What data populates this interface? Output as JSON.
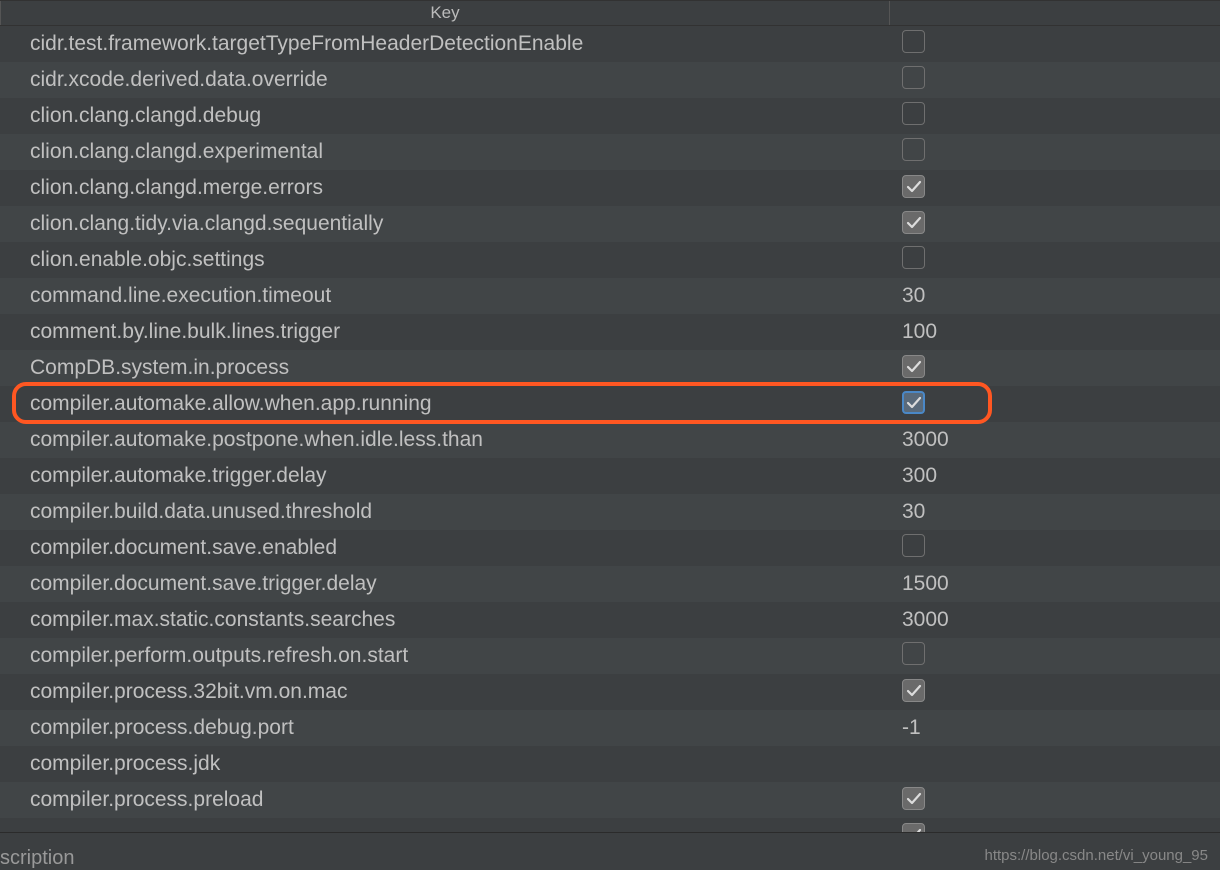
{
  "header": {
    "key_label": "Key"
  },
  "rows": [
    {
      "key": "cidr.test.framework.targetTypeFromHeaderDetectionEnable",
      "type": "checkbox",
      "checked": false,
      "focused": false
    },
    {
      "key": "cidr.xcode.derived.data.override",
      "type": "checkbox",
      "checked": false,
      "focused": false
    },
    {
      "key": "clion.clang.clangd.debug",
      "type": "checkbox",
      "checked": false,
      "focused": false
    },
    {
      "key": "clion.clang.clangd.experimental",
      "type": "checkbox",
      "checked": false,
      "focused": false
    },
    {
      "key": "clion.clang.clangd.merge.errors",
      "type": "checkbox",
      "checked": true,
      "focused": false
    },
    {
      "key": "clion.clang.tidy.via.clangd.sequentially",
      "type": "checkbox",
      "checked": true,
      "focused": false
    },
    {
      "key": "clion.enable.objc.settings",
      "type": "checkbox",
      "checked": false,
      "focused": false
    },
    {
      "key": "command.line.execution.timeout",
      "type": "text",
      "value": "30"
    },
    {
      "key": "comment.by.line.bulk.lines.trigger",
      "type": "text",
      "value": "100"
    },
    {
      "key": "CompDB.system.in.process",
      "type": "checkbox",
      "checked": true,
      "focused": false
    },
    {
      "key": "compiler.automake.allow.when.app.running",
      "type": "checkbox",
      "checked": true,
      "focused": true,
      "highlighted": true
    },
    {
      "key": "compiler.automake.postpone.when.idle.less.than",
      "type": "text",
      "value": "3000"
    },
    {
      "key": "compiler.automake.trigger.delay",
      "type": "text",
      "value": "300"
    },
    {
      "key": "compiler.build.data.unused.threshold",
      "type": "text",
      "value": "30"
    },
    {
      "key": "compiler.document.save.enabled",
      "type": "checkbox",
      "checked": false,
      "focused": false
    },
    {
      "key": "compiler.document.save.trigger.delay",
      "type": "text",
      "value": "1500"
    },
    {
      "key": "compiler.max.static.constants.searches",
      "type": "text",
      "value": "3000"
    },
    {
      "key": "compiler.perform.outputs.refresh.on.start",
      "type": "checkbox",
      "checked": false,
      "focused": false
    },
    {
      "key": "compiler.process.32bit.vm.on.mac",
      "type": "checkbox",
      "checked": true,
      "focused": false
    },
    {
      "key": "compiler.process.debug.port",
      "type": "text",
      "value": "-1"
    },
    {
      "key": "compiler.process.jdk",
      "type": "text",
      "value": ""
    },
    {
      "key": "compiler.process.preload",
      "type": "checkbox",
      "checked": true,
      "focused": false
    },
    {
      "key": "",
      "type": "checkbox",
      "checked": true,
      "focused": false
    }
  ],
  "bottom": {
    "label_fragment": "scription"
  },
  "watermark": "https://blog.csdn.net/vi_young_95"
}
